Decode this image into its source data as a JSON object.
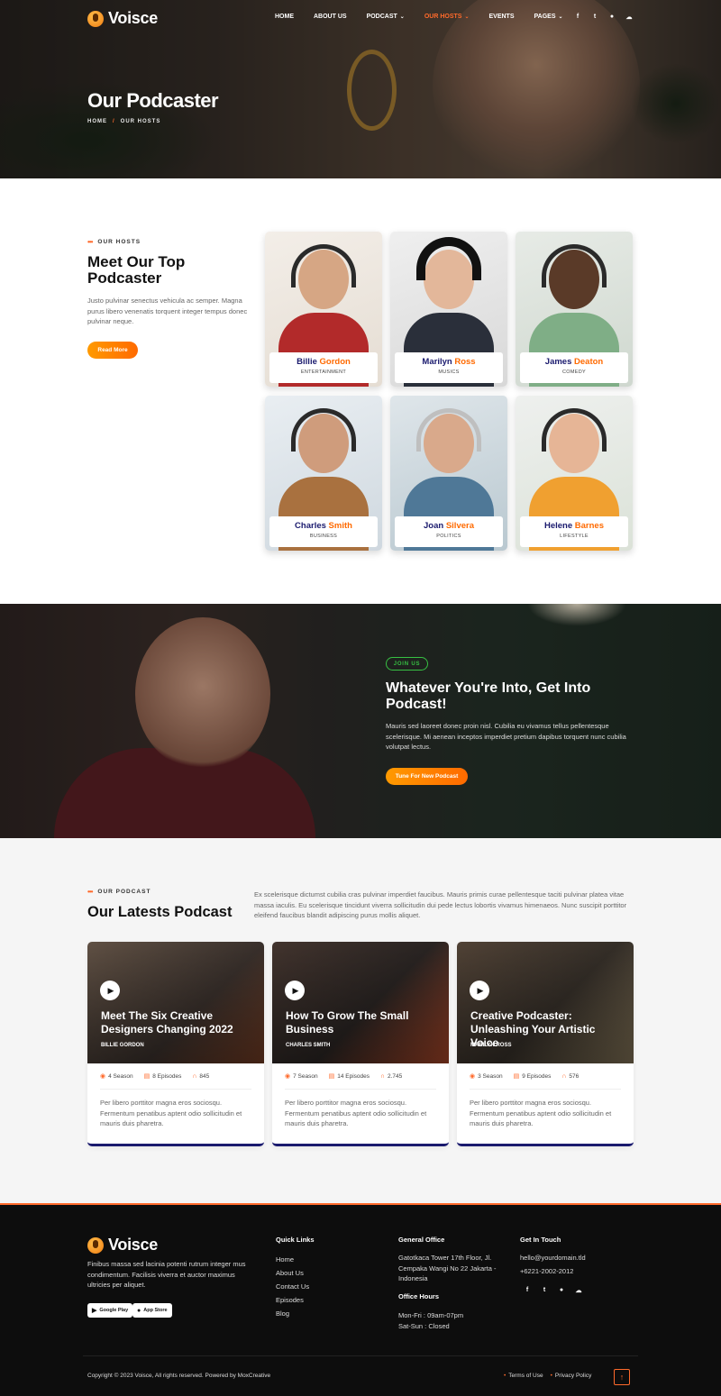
{
  "brand": {
    "name": "Voisce"
  },
  "nav": {
    "items": [
      {
        "label": "HOME",
        "active": false,
        "dropdown": false
      },
      {
        "label": "ABOUT US",
        "active": false,
        "dropdown": false
      },
      {
        "label": "PODCAST",
        "active": false,
        "dropdown": true
      },
      {
        "label": "OUR HOSTS",
        "active": true,
        "dropdown": true
      },
      {
        "label": "EVENTS",
        "active": false,
        "dropdown": false
      },
      {
        "label": "PAGES",
        "active": false,
        "dropdown": true
      }
    ],
    "socials": [
      "facebook-icon",
      "twitter-icon",
      "dribbble-icon",
      "soundcloud-icon"
    ]
  },
  "hero": {
    "title": "Our Podcaster",
    "breadcrumb": [
      "HOME",
      "/",
      "OUR HOSTS"
    ]
  },
  "hosts": {
    "eyebrow": "OUR HOSTS",
    "title": "Meet Our Top Podcaster",
    "description": "Justo pulvinar senectus vehicula ac semper. Magna purus libero venenatis torquent integer tempus donec pulvinar neque.",
    "button": "Read More",
    "cards": [
      {
        "first": "Billie",
        "last": "Gordon",
        "role": "ENTERTAINMENT"
      },
      {
        "first": "Marilyn",
        "last": "Ross",
        "role": "MUSICS"
      },
      {
        "first": "James",
        "last": "Deaton",
        "role": "COMEDY"
      },
      {
        "first": "Charles",
        "last": "Smith",
        "role": "BUSINESS"
      },
      {
        "first": "Joan",
        "last": "Silvera",
        "role": "POLITICS"
      },
      {
        "first": "Helene",
        "last": "Barnes",
        "role": "LIFESTYLE"
      }
    ]
  },
  "join": {
    "pill": "JOIN US",
    "title": "Whatever You're Into, Get Into Podcast!",
    "description": "Mauris sed laoreet donec proin nisl. Cubilia eu vivamus tellus pellentesque scelerisque. Mi aenean inceptos imperdiet pretium dapibus torquent nunc cubilia volutpat lectus.",
    "button": "Tune For New Podcast"
  },
  "latest": {
    "eyebrow": "OUR PODCAST",
    "title": "Our Latests Podcast",
    "description": "Ex scelerisque dictumst cubilia cras pulvinar imperdiet faucibus. Mauris primis curae pellentesque taciti pulvinar platea vitae massa iaculis. Eu scelerisque tincidunt viverra sollicitudin dui pede lectus lobortis vivamus himenaeos. Nunc suscipit porttitor eleifend faucibus blandit adipiscing purus mollis aliquet.",
    "cards": [
      {
        "title": "Meet The Six Creative Designers Changing 2022",
        "author": "BILLIE GORDON",
        "seasons": "4 Season",
        "episodes": "8 Episodes",
        "listens": "845",
        "description": "Per libero porttitor magna eros sociosqu. Fermentum penatibus aptent odio sollicitudin et mauris duis pharetra."
      },
      {
        "title": "How To Grow The Small Business",
        "author": "CHARLES SMITH",
        "seasons": "7 Season",
        "episodes": "14 Episodes",
        "listens": "2.745",
        "description": "Per libero porttitor magna eros sociosqu. Fermentum penatibus aptent odio sollicitudin et mauris duis pharetra."
      },
      {
        "title": "Creative Podcaster: Unleashing Your Artistic Voice",
        "author": "MARILYN ROSS",
        "seasons": "3 Season",
        "episodes": "9 Episodes",
        "listens": "576",
        "description": "Per libero porttitor magna eros sociosqu. Fermentum penatibus aptent odio sollicitudin et mauris duis pharetra."
      }
    ]
  },
  "footer": {
    "about": "Finibus massa sed lacinia potenti rutrum integer mus condimentum. Facilisis viverra et auctor maximus ultricies per aliquet.",
    "stores": [
      "Google Play",
      "App Store"
    ],
    "quick_links_title": "Quick Links",
    "quick_links": [
      "Home",
      "About Us",
      "Contact Us",
      "Episodes",
      "Blog"
    ],
    "office_title": "General Office",
    "office_address": "Gatotkaca Tower 17th Floor, Jl. Cempaka Wangi No 22 Jakarta - Indonesia",
    "hours_title": "Office Hours",
    "hours": [
      "Mon-Fri : 09am-07pm",
      "Sat-Sun : Closed"
    ],
    "contact_title": "Get In Touch",
    "email": "hello@yourdomain.tld",
    "phone": "+6221-2002-2012",
    "copyright": "Copyright © 2023 Voisce, All rights reserved. Powered by MoxCreative",
    "legal": [
      "Terms of Use",
      "Privacy Policy"
    ]
  },
  "colors": {
    "accent": "#ff6a2b",
    "navy": "#1a1a6e",
    "green": "#37c043",
    "footer_bg": "#0d0d0d"
  }
}
